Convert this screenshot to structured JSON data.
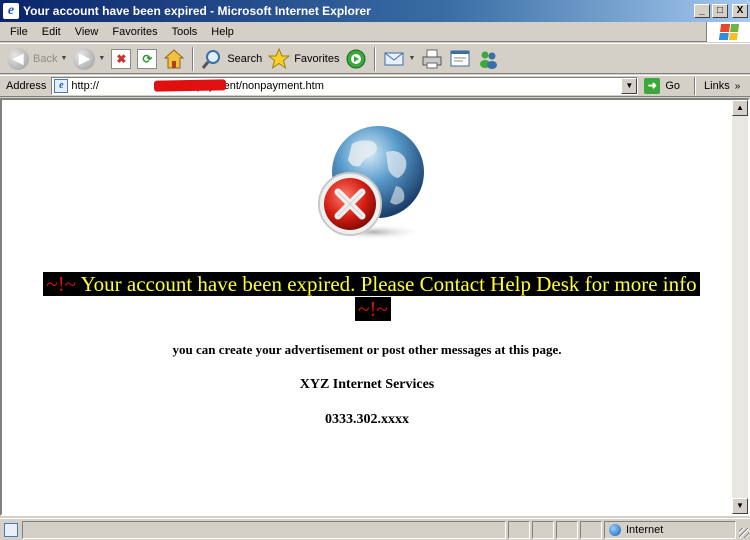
{
  "window": {
    "title": "Your account have been expired - Microsoft Internet Explorer",
    "minimize": "_",
    "maximize": "□",
    "close": "X"
  },
  "menu": [
    "File",
    "Edit",
    "View",
    "Favorites",
    "Tools",
    "Help"
  ],
  "toolbar": {
    "back_label": "Back",
    "search_label": "Search",
    "favorites_label": "Favorites"
  },
  "address": {
    "label": "Address",
    "url": "http://                       0/nonpayment/nonpayment.htm",
    "go_label": "Go",
    "links_label": "Links"
  },
  "page": {
    "tilde_left": "~!~",
    "headline": " Your account have been expired. Please Contact Help Desk for more info ",
    "tilde_right": "~!~",
    "line1": "you can create your advertisement or post other messages at this page.",
    "line2": "XYZ Internet Services",
    "line3": "0333.302.xxxx"
  },
  "status": {
    "zone": "Internet"
  },
  "colors": {
    "headline_bg": "#000000",
    "headline_text": "#ffff33",
    "tilde": "#e01010",
    "title_bar": "#0a246a"
  }
}
